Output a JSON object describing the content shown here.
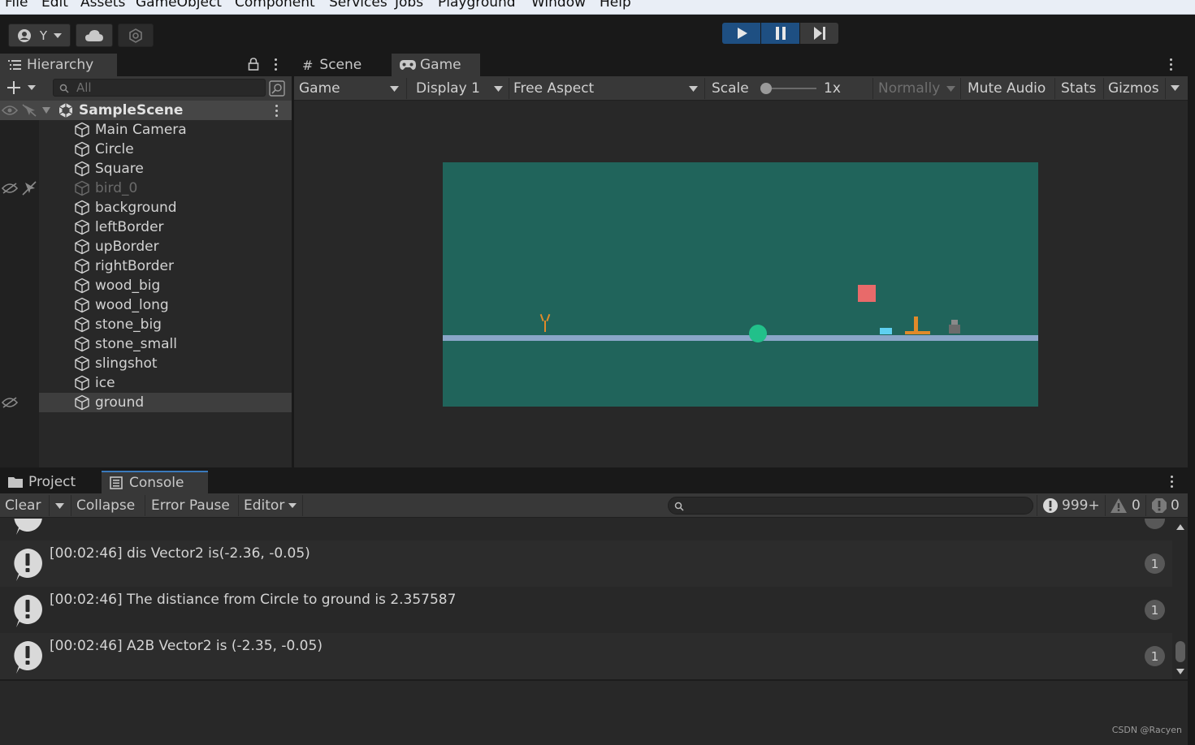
{
  "menu": [
    "File",
    "Edit",
    "Assets",
    "GameObject",
    "Component",
    "Services",
    "Jobs",
    "Playground",
    "Window",
    "Help"
  ],
  "toolbar": {
    "account_label": "Y"
  },
  "hierarchy": {
    "tab_label": "Hierarchy",
    "search_placeholder": "All",
    "scene_name": "SampleScene",
    "items": [
      {
        "label": "Main Camera"
      },
      {
        "label": "Circle"
      },
      {
        "label": "Square"
      },
      {
        "label": "bird_0"
      },
      {
        "label": "background"
      },
      {
        "label": "leftBorder"
      },
      {
        "label": "upBorder"
      },
      {
        "label": "rightBorder"
      },
      {
        "label": "wood_big"
      },
      {
        "label": "wood_long"
      },
      {
        "label": "stone_big"
      },
      {
        "label": "stone_small"
      },
      {
        "label": "slingshot"
      },
      {
        "label": "ice"
      },
      {
        "label": "ground"
      }
    ]
  },
  "gameview": {
    "tabs": [
      {
        "label": "Scene"
      },
      {
        "label": "Game"
      }
    ],
    "display_mode": "Game",
    "display": "Display 1",
    "aspect": "Free Aspect",
    "scale_label": "Scale",
    "scale_value": "1x",
    "play_mode": "Normally",
    "mute_label": "Mute Audio",
    "stats_label": "Stats",
    "gizmos_label": "Gizmos"
  },
  "console": {
    "tabs": [
      {
        "label": "Project"
      },
      {
        "label": "Console"
      }
    ],
    "clear_label": "Clear",
    "collapse_label": "Collapse",
    "error_pause_label": "Error Pause",
    "editor_label": "Editor",
    "log_count": "999+",
    "warn_count": "0",
    "error_count": "0",
    "entries": [
      {
        "text": "[00:02:46]  dis Vector2 is(-2.36, -0.05)",
        "count": "1"
      },
      {
        "text": "[00:02:46] The distiance from Circle to ground is 2.357587",
        "count": "1"
      },
      {
        "text": "[00:02:46] A2B Vector2 is (-2.35, -0.05)",
        "count": "1"
      }
    ]
  },
  "colors": {
    "game_background": "#20645b",
    "ground_line": "#8aa6c8",
    "circle": "#22c08a",
    "square": "#e86a6a",
    "ice": "#5fd0f0",
    "wood": "#e08a2a",
    "play_active": "#1e4f82"
  },
  "watermark": "CSDN @Racyen"
}
